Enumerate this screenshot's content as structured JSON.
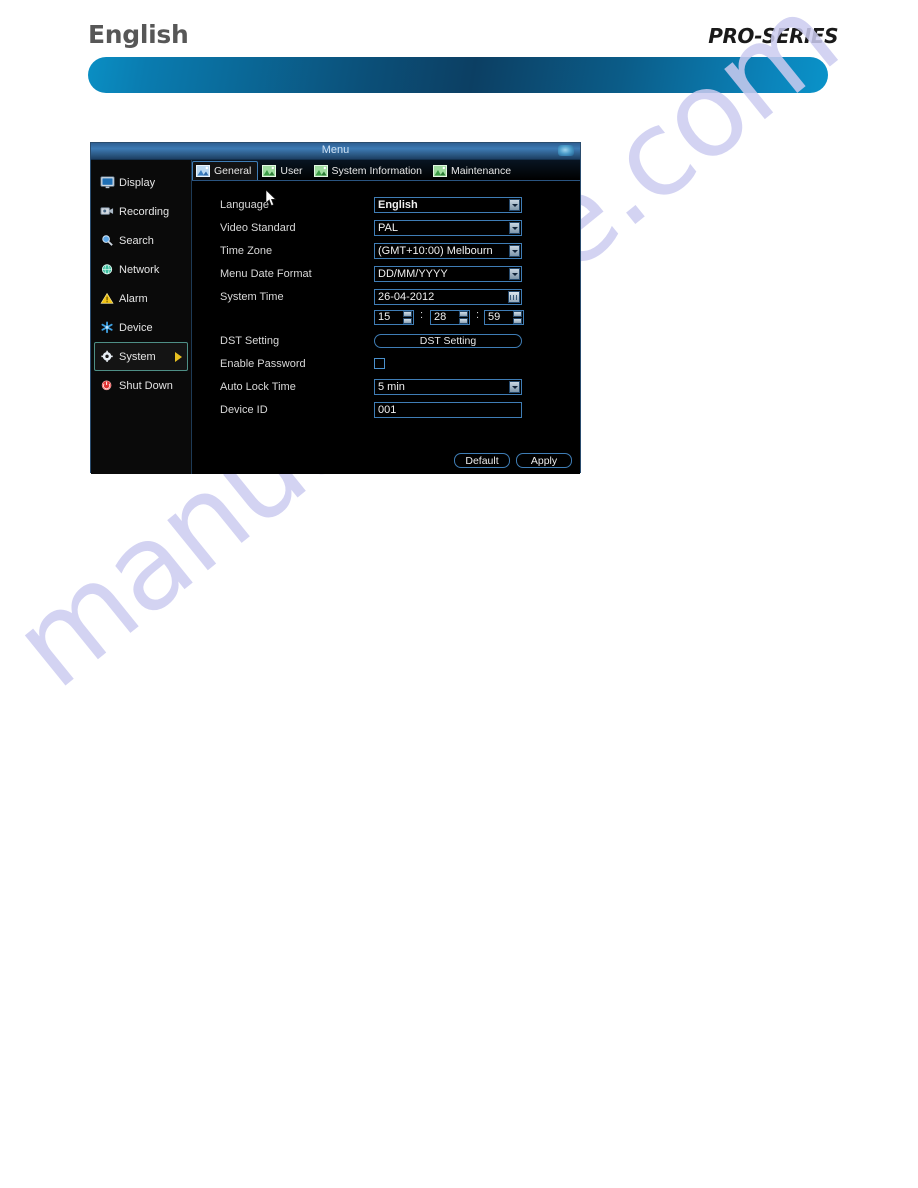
{
  "header": {
    "language_label": "English",
    "brand": "PRO-SERIES"
  },
  "watermark": {
    "text": "manualshive.com"
  },
  "window": {
    "title": "Menu",
    "close_icon": "close-round-icon"
  },
  "sidebar": {
    "items": [
      {
        "label": "Display",
        "icon": "monitor-icon",
        "selected": false
      },
      {
        "label": "Recording",
        "icon": "camera-icon",
        "selected": false
      },
      {
        "label": "Search",
        "icon": "magnifier-icon",
        "selected": false
      },
      {
        "label": "Network",
        "icon": "globe-icon",
        "selected": false
      },
      {
        "label": "Alarm",
        "icon": "warning-triangle-icon",
        "selected": false
      },
      {
        "label": "Device",
        "icon": "snowflake-icon",
        "selected": false
      },
      {
        "label": "System",
        "icon": "gear-icon",
        "selected": true
      },
      {
        "label": "Shut Down",
        "icon": "power-icon",
        "selected": false
      }
    ],
    "selected_arrow_color": "#e8c020"
  },
  "tabs": [
    {
      "label": "General",
      "icon": "picture-icon",
      "active": true
    },
    {
      "label": "User",
      "icon": "picture-icon",
      "active": false
    },
    {
      "label": "System Information",
      "icon": "picture-icon",
      "active": false
    },
    {
      "label": "Maintenance",
      "icon": "picture-icon",
      "active": false
    }
  ],
  "form": {
    "language": {
      "label": "Language",
      "value": "English"
    },
    "video_standard": {
      "label": "Video Standard",
      "value": "PAL"
    },
    "time_zone": {
      "label": "Time Zone",
      "value": "(GMT+10:00) Melbourn"
    },
    "date_format": {
      "label": "Menu Date Format",
      "value": "DD/MM/YYYY"
    },
    "system_time": {
      "label": "System Time",
      "value": "26-04-2012",
      "calendar_icon": "calendar-icon"
    },
    "time": {
      "hours": "15",
      "minutes": "28",
      "seconds": "59",
      "separator": ":"
    },
    "dst": {
      "label": "DST Setting",
      "button": "DST Setting"
    },
    "enable_password": {
      "label": "Enable Password",
      "checked": false
    },
    "auto_lock": {
      "label": "Auto Lock Time",
      "value": "5 min"
    },
    "device_id": {
      "label": "Device ID",
      "value": "001"
    }
  },
  "footer": {
    "default_label": "Default",
    "apply_label": "Apply"
  },
  "colors": {
    "accent_blue": "#3f7db5",
    "title_gradient_start": "#3d7ab4",
    "selected_border": "#4e8f86",
    "arrow_yellow": "#e8c020",
    "header_bar_cyan": "#0a8fc4",
    "header_bar_dark": "#0c3f63"
  }
}
